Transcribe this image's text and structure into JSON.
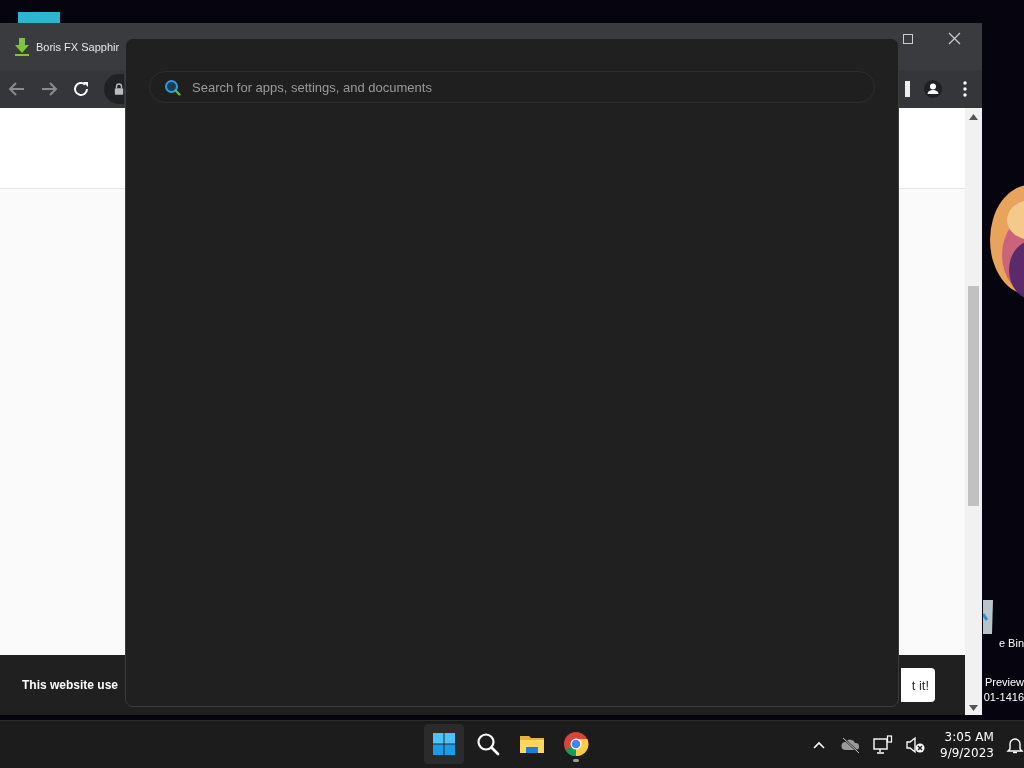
{
  "desktop": {
    "icons": [
      {
        "kind": "recycle-bin",
        "label": "e Bin"
      },
      {
        "kind": "text",
        "label": "Preview"
      },
      {
        "kind": "text",
        "label": "01-1416"
      }
    ]
  },
  "browser": {
    "tab": {
      "title": "Boris FX Sapphir"
    },
    "cookie_banner": {
      "text": "This website use",
      "button": "t it!"
    }
  },
  "search_panel": {
    "search": {
      "placeholder": "Search for apps, settings, and documents"
    }
  },
  "taskbar": {
    "apps": [
      {
        "kind": "start",
        "highlighted": true,
        "running": false
      },
      {
        "kind": "search",
        "highlighted": false,
        "running": false
      },
      {
        "kind": "explorer",
        "highlighted": false,
        "running": false
      },
      {
        "kind": "chrome",
        "highlighted": false,
        "running": true
      }
    ],
    "clock": {
      "time": "3:05 AM",
      "date": "9/9/2023"
    }
  }
}
